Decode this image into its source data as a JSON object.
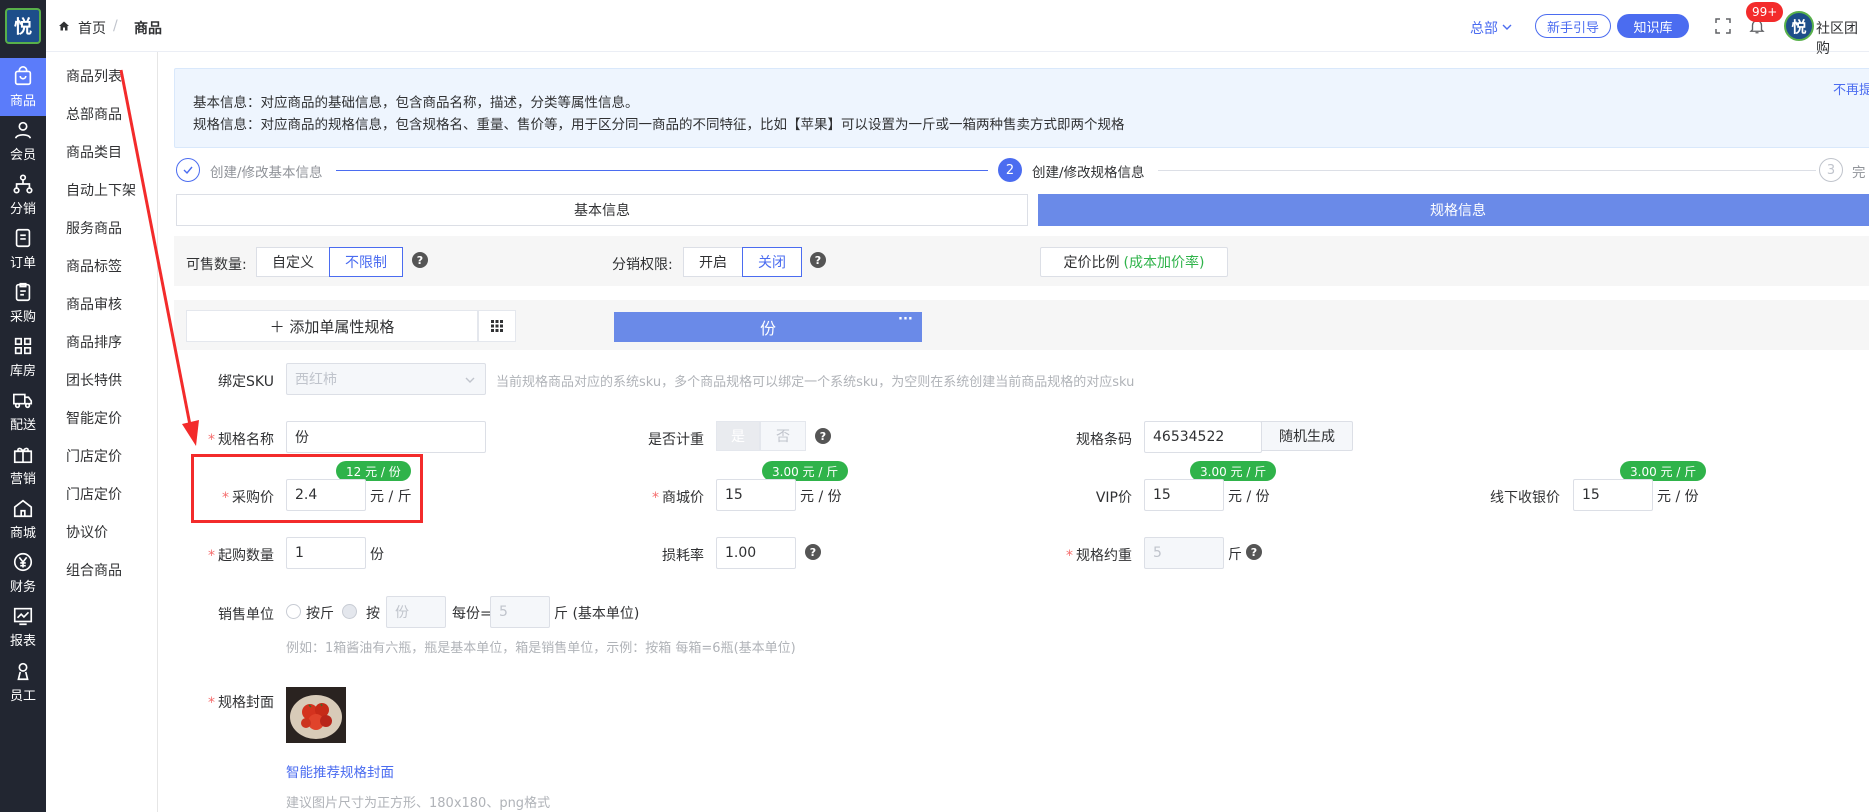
{
  "brand": {
    "logo_text": "悦",
    "accent": "#5b7cfa",
    "green": "#2fb34a",
    "red": "#f32b2b"
  },
  "rail": [
    {
      "label": "商品",
      "icon": "bag-icon",
      "active": true
    },
    {
      "label": "会员",
      "icon": "user-icon"
    },
    {
      "label": "分销",
      "icon": "tree-icon"
    },
    {
      "label": "订单",
      "icon": "doc-icon"
    },
    {
      "label": "采购",
      "icon": "clipboard-icon"
    },
    {
      "label": "库房",
      "icon": "grid-icon"
    },
    {
      "label": "配送",
      "icon": "truck-icon"
    },
    {
      "label": "营销",
      "icon": "gift-icon"
    },
    {
      "label": "商城",
      "icon": "home-icon"
    },
    {
      "label": "财务",
      "icon": "yen-icon"
    },
    {
      "label": "报表",
      "icon": "chart-icon"
    },
    {
      "label": "员工",
      "icon": "staff-icon"
    }
  ],
  "submenu": [
    "商品列表",
    "总部商品",
    "商品类目",
    "自动上下架",
    "服务商品",
    "商品标签",
    "商品审核",
    "商品排序",
    "团长特供",
    "智能定价",
    "门店定价",
    "门店定价",
    "协议价",
    "组合商品"
  ],
  "topbar": {
    "home": "首页",
    "sep": "/",
    "current": "商品",
    "org": "总部",
    "guide": "新手引导",
    "kb": "知识库",
    "notif_count": "99+",
    "user": "社区团购"
  },
  "info": {
    "line1": "基本信息：对应商品的基础信息，包含商品名称，描述，分类等属性信息。",
    "line2": "规格信息：对应商品的规格信息，包含规格名、重量、售价等，用于区分同一商品的不同特征，比如【苹果】可以设置为一斤或一箱两种售卖方式即两个规格",
    "dismiss": "不再提"
  },
  "steps": {
    "s1": "创建/修改基本信息",
    "s2_num": "2",
    "s2": "创建/修改规格信息",
    "s3_num": "3",
    "s3": "完"
  },
  "tabs": {
    "basic": "基本信息",
    "spec": "规格信息"
  },
  "options": {
    "sellable_label": "可售数量:",
    "custom": "自定义",
    "unlimited": "不限制",
    "dist_label": "分销权限:",
    "on": "开启",
    "off": "关闭",
    "ratio": "定价比例",
    "ratio_green": "(成本加价率)"
  },
  "spec": {
    "add_btn": "＋ 添加单属性规格",
    "tab_name": "份",
    "more": "···"
  },
  "form": {
    "sku_label": "绑定SKU",
    "sku_value": "西红柿",
    "sku_hint": "当前规格商品对应的系统sku，多个商品规格可以绑定一个系统sku，为空则在系统创建当前商品规格的对应sku",
    "name_label": "规格名称",
    "name_value": "份",
    "weigh_label": "是否计重",
    "weigh_yes": "是",
    "weigh_no": "否",
    "barcode_label": "规格条码",
    "barcode_value": "46534522",
    "random_btn": "随机生成",
    "purchase_label": "采购价",
    "purchase_value": "2.4",
    "purchase_unit": "元 / 斤",
    "purchase_badge": "12 元 / 份",
    "mall_label": "商城价",
    "mall_value": "15",
    "mall_unit": "元 / 份",
    "mall_badge": "3.00 元 / 斤",
    "vip_label": "VIP价",
    "vip_value": "15",
    "vip_unit": "元 / 份",
    "vip_badge": "3.00 元 / 斤",
    "offline_label": "线下收银价",
    "offline_value": "15",
    "offline_unit": "元 / 份",
    "offline_badge": "3.00 元 / 斤",
    "min_label": "起购数量",
    "min_value": "1",
    "min_unit": "份",
    "loss_label": "损耗率",
    "loss_value": "1.00",
    "weight_label": "规格约重",
    "weight_value": "5",
    "weight_unit": "斤",
    "unit_label": "销售单位",
    "unit_opt1": "按斤",
    "unit_opt2": "按",
    "unit_input": "份",
    "per": "每份=",
    "per_value": "5",
    "per_unit": "斤 (基本单位)",
    "unit_hint": "例如：1箱酱油有六瓶，瓶是基本单位，箱是销售单位，示例：按箱 每箱=6瓶(基本单位)",
    "cover_label": "规格封面",
    "cover_link": "智能推荐规格封面",
    "cover_hint": "建议图片尺寸为正方形、180x180、png格式"
  }
}
